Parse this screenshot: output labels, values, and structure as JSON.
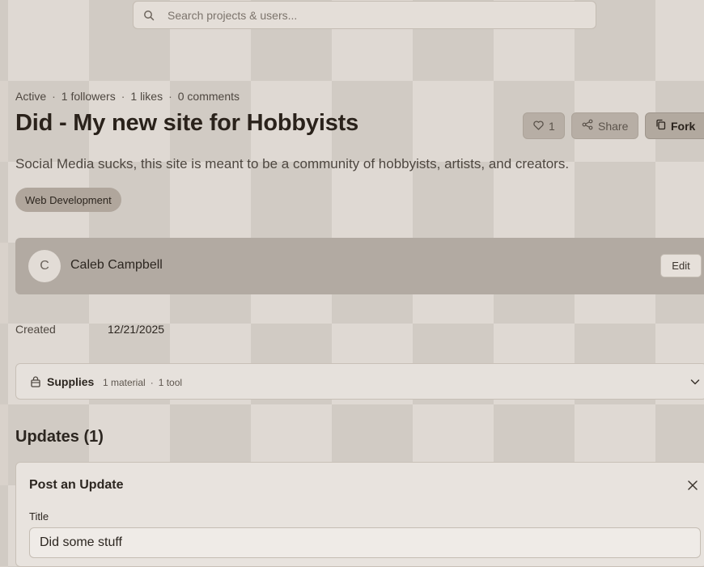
{
  "search": {
    "placeholder": "Search projects & users..."
  },
  "project": {
    "status": "Active",
    "followers": "1 followers",
    "likes": "1 likes",
    "comments": "0 comments",
    "title": "Did - My new site for Hobbyists",
    "description": "Social Media sucks, this site is meant to be a community of hobbyists, artists, and creators.",
    "tag": "Web Development",
    "created_label": "Created",
    "created_value": "12/21/2025"
  },
  "actions": {
    "like_count": "1",
    "share_label": "Share",
    "fork_label": "Fork"
  },
  "owner": {
    "initial": "C",
    "name": "Caleb Campbell",
    "edit_label": "Edit"
  },
  "supplies": {
    "label": "Supplies",
    "materials": "1 material",
    "tools": "1 tool"
  },
  "updates": {
    "heading": "Updates (1)",
    "form_title": "Post an Update",
    "title_label": "Title",
    "title_value": "Did some stuff"
  },
  "icons": {
    "search": "search-icon",
    "heart": "heart-icon",
    "share": "share-icon",
    "fork": "copy-icon",
    "bag": "bag-icon",
    "chevron": "chevron-down-icon",
    "close": "close-icon"
  }
}
